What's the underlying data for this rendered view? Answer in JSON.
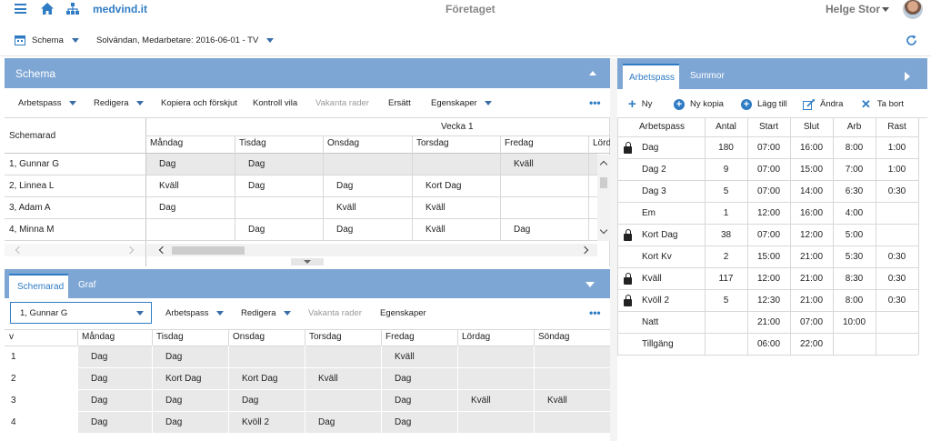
{
  "app": {
    "brand": "medvind.it",
    "company_title": "Företaget",
    "user_name": "Helge Stor"
  },
  "subbar": {
    "module_label": "Schema",
    "context_label": "Solvändan, Medarbetare: 2016-06-01 - TV"
  },
  "schema_panel": {
    "title": "Schema",
    "toolbar": {
      "arbetspass": "Arbetspass",
      "redigera": "Redigera",
      "kopiera": "Kopiera och förskjut",
      "kontroll": "Kontroll vila",
      "vakanta": "Vakanta rader",
      "ersatt": "Ersätt",
      "egenskaper": "Egenskaper"
    },
    "row_header": "Schemarad",
    "week_label": "Vecka 1",
    "days": [
      "Måndag",
      "Tisdag",
      "Onsdag",
      "Torsdag",
      "Fredag",
      "Lörd"
    ],
    "rows": [
      {
        "name": "1, Gunnar G",
        "cells": [
          "Dag",
          "Dag",
          "",
          "",
          "Kväll",
          ""
        ]
      },
      {
        "name": "2, Linnea L",
        "cells": [
          "Kväll",
          "Dag",
          "Dag",
          "Kort Dag",
          "",
          ""
        ]
      },
      {
        "name": "3, Adam A",
        "cells": [
          "Dag",
          "",
          "Kväll",
          "Kväll",
          "",
          ""
        ]
      },
      {
        "name": "4, Minna M",
        "cells": [
          "",
          "Dag",
          "Dag",
          "Kväll",
          "Dag",
          ""
        ]
      }
    ]
  },
  "bottom_panel": {
    "tabs": [
      "Schemarad",
      "Graf"
    ],
    "select_value": "1, Gunnar G",
    "toolbar": {
      "arbetspass": "Arbetspass",
      "redigera": "Redigera",
      "vakanta": "Vakanta rader",
      "egenskaper": "Egenskaper"
    },
    "headers": [
      "v",
      "Måndag",
      "Tisdag",
      "Onsdag",
      "Torsdag",
      "Fredag",
      "Lördag",
      "Söndag"
    ],
    "rows": [
      [
        "1",
        "Dag",
        "Dag",
        "",
        "",
        "Kväll",
        "",
        ""
      ],
      [
        "2",
        "Dag",
        "Kort Dag",
        "Kort Dag",
        "Kväll",
        "Dag",
        "",
        ""
      ],
      [
        "3",
        "Dag",
        "Dag",
        "Dag",
        "",
        "Dag",
        "Kväll",
        "Kväll"
      ],
      [
        "4",
        "Dag",
        "Dag",
        "Kvöll 2",
        "Dag",
        "Dag",
        "",
        ""
      ]
    ]
  },
  "right_panel": {
    "tabs": [
      "Arbetspass",
      "Summor"
    ],
    "toolbar": {
      "ny": "Ny",
      "ny_kopia": "Ny kopia",
      "lagg_till": "Lägg till",
      "andra": "Ändra",
      "ta_bort": "Ta bort"
    },
    "headers": [
      "Arbetspass",
      "Antal",
      "Start",
      "Slut",
      "Arb",
      "Rast"
    ],
    "rows": [
      {
        "locked": true,
        "name": "Dag",
        "antal": "180",
        "start": "07:00",
        "slut": "16:00",
        "arb": "8:00",
        "rast": "1:00"
      },
      {
        "locked": false,
        "name": "Dag 2",
        "antal": "9",
        "start": "07:00",
        "slut": "15:00",
        "arb": "7:00",
        "rast": "1:00"
      },
      {
        "locked": false,
        "name": "Dag 3",
        "antal": "5",
        "start": "07:00",
        "slut": "14:00",
        "arb": "6:30",
        "rast": "0:30"
      },
      {
        "locked": false,
        "name": "Em",
        "antal": "1",
        "start": "12:00",
        "slut": "16:00",
        "arb": "4:00",
        "rast": ""
      },
      {
        "locked": true,
        "name": "Kort Dag",
        "antal": "38",
        "start": "07:00",
        "slut": "12:00",
        "arb": "5:00",
        "rast": ""
      },
      {
        "locked": false,
        "name": "Kort Kv",
        "antal": "2",
        "start": "15:00",
        "slut": "21:00",
        "arb": "5:30",
        "rast": "0:30"
      },
      {
        "locked": true,
        "name": "Kväll",
        "antal": "117",
        "start": "12:00",
        "slut": "21:00",
        "arb": "8:30",
        "rast": "0:30"
      },
      {
        "locked": true,
        "name": "Kvöll 2",
        "antal": "5",
        "start": "12:30",
        "slut": "21:00",
        "arb": "8:00",
        "rast": "0:30"
      },
      {
        "locked": false,
        "name": "Natt",
        "antal": "",
        "start": "21:00",
        "slut": "07:00",
        "arb": "10:00",
        "rast": ""
      },
      {
        "locked": false,
        "name": "Tillgäng",
        "antal": "",
        "start": "06:00",
        "slut": "22:00",
        "arb": "",
        "rast": ""
      }
    ]
  },
  "colors": {
    "accent": "#2f7cc4",
    "panel_header": "#7ea6d4",
    "cell_shade": "#e9e9e9"
  }
}
